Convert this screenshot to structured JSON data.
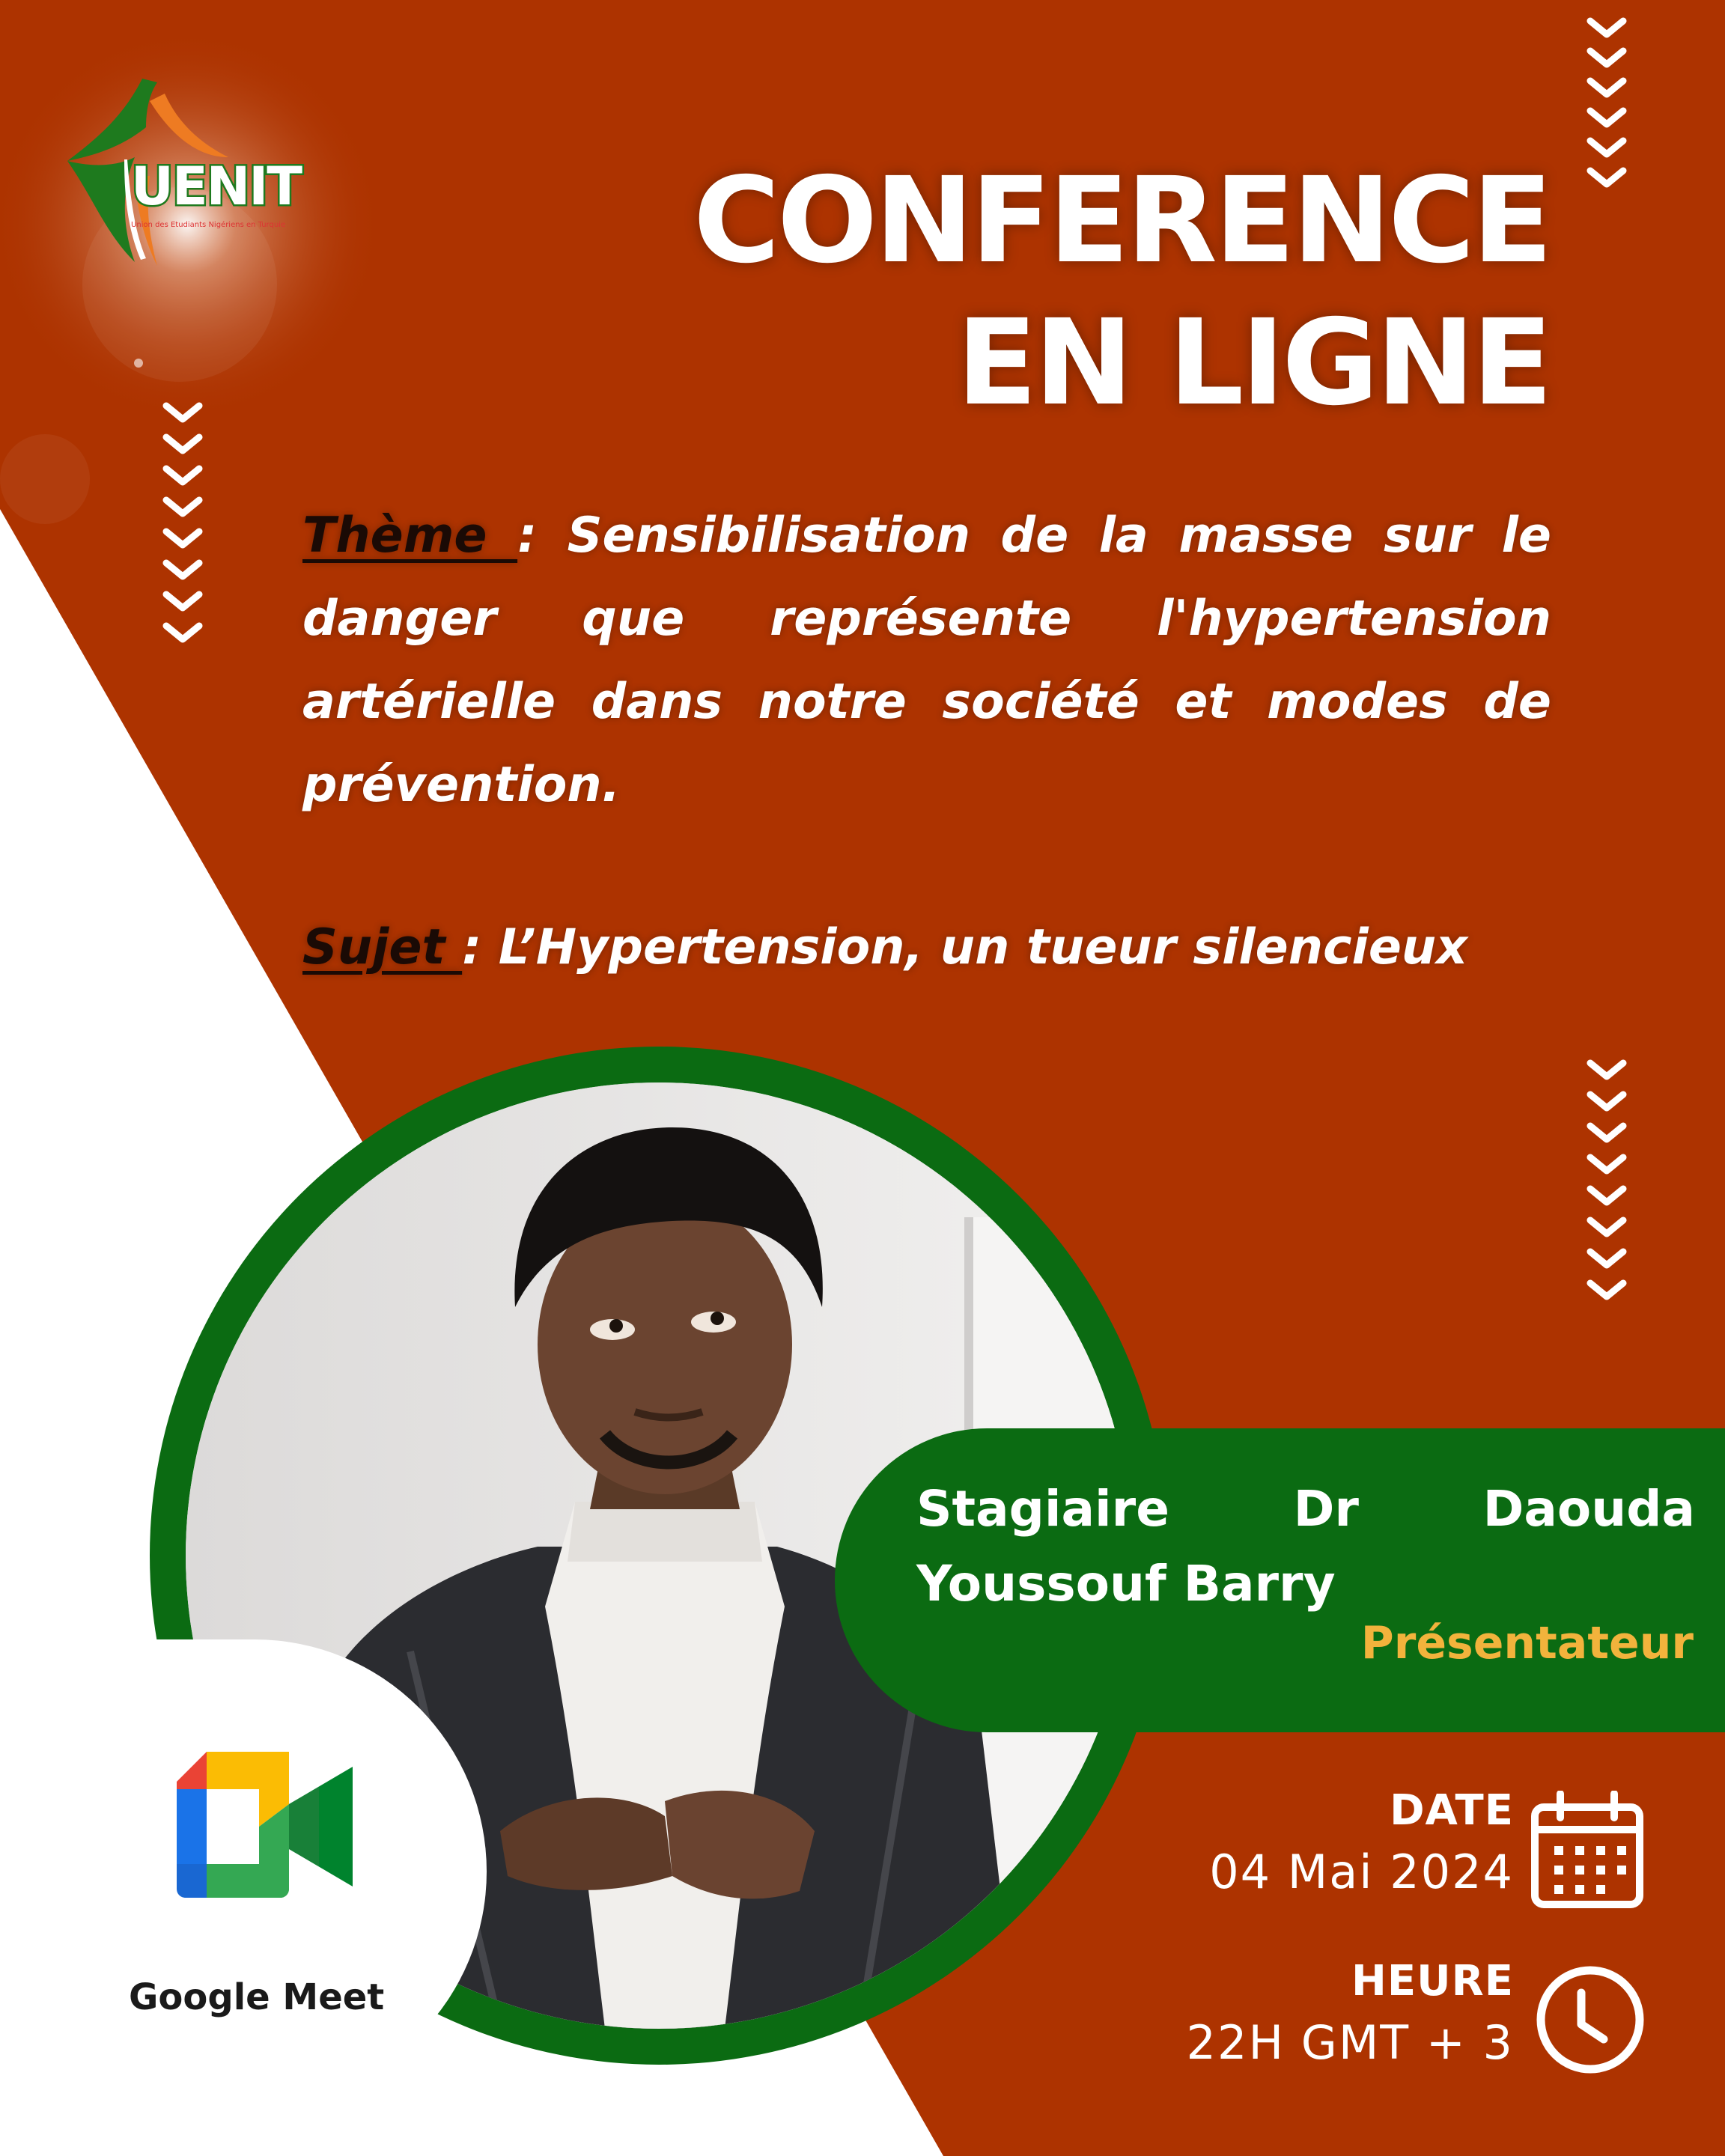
{
  "colors": {
    "background": "#ad3300",
    "triangle": "#ffffff",
    "green": "#0b6b12",
    "accent_yellow": "#f2b33c",
    "title": "#ffffff"
  },
  "logo": {
    "name": "UENIT",
    "subtitle": "Union des Etudiants Nigériens en Turquie"
  },
  "title": {
    "line1": "CONFERENCE",
    "line2": "EN LIGNE"
  },
  "theme": {
    "label": "Thème ",
    "separator": " : ",
    "text": "Sensibilisation de la masse sur le danger que représente l'hypertension artérielle dans notre société et modes de prévention."
  },
  "sujet": {
    "label": "Sujet ",
    "separator": " :  ",
    "text": "L’Hypertension, un tueur silencieux"
  },
  "presenter": {
    "word1": "Stagiaire",
    "word2": "Dr",
    "word3": "Daouda",
    "line2": "Youssouf Barry",
    "role": "Présentateur"
  },
  "platform": {
    "name": "Google Meet",
    "icon": "google-meet-icon"
  },
  "schedule": {
    "date_label": "DATE",
    "date_value": "04 Mai 2024",
    "date_icon": "calendar-icon",
    "time_label": "HEURE",
    "time_value": "22H GMT + 3",
    "time_icon": "clock-icon"
  },
  "decorations": {
    "chevron_icon": "chevron-down-icon"
  }
}
